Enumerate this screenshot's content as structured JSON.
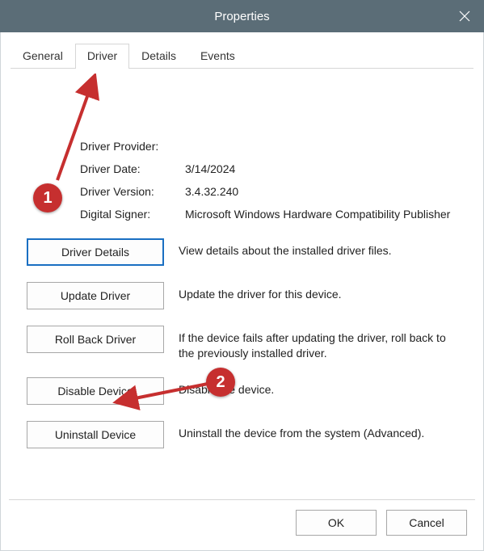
{
  "title": "Properties",
  "tabs": [
    {
      "label": "General"
    },
    {
      "label": "Driver"
    },
    {
      "label": "Details"
    },
    {
      "label": "Events"
    }
  ],
  "active_tab_index": 1,
  "info": {
    "provider_label": "Driver Provider:",
    "provider_value": "",
    "date_label": "Driver Date:",
    "date_value": "3/14/2024",
    "version_label": "Driver Version:",
    "version_value": "3.4.32.240",
    "signer_label": "Digital Signer:",
    "signer_value": "Microsoft Windows Hardware Compatibility Publisher"
  },
  "actions": {
    "details": {
      "btn": "Driver Details",
      "desc": "View details about the installed driver files."
    },
    "update": {
      "btn": "Update Driver",
      "desc": "Update the driver for this device."
    },
    "rollback": {
      "btn": "Roll Back Driver",
      "desc": "If the device fails after updating the driver, roll back to the previously installed driver."
    },
    "disable": {
      "btn": "Disable Device",
      "desc": "Disable the device."
    },
    "uninstall": {
      "btn": "Uninstall Device",
      "desc": "Uninstall the device from the system (Advanced)."
    }
  },
  "footer": {
    "ok": "OK",
    "cancel": "Cancel"
  },
  "annotations": {
    "badge1": "1",
    "badge2": "2"
  }
}
